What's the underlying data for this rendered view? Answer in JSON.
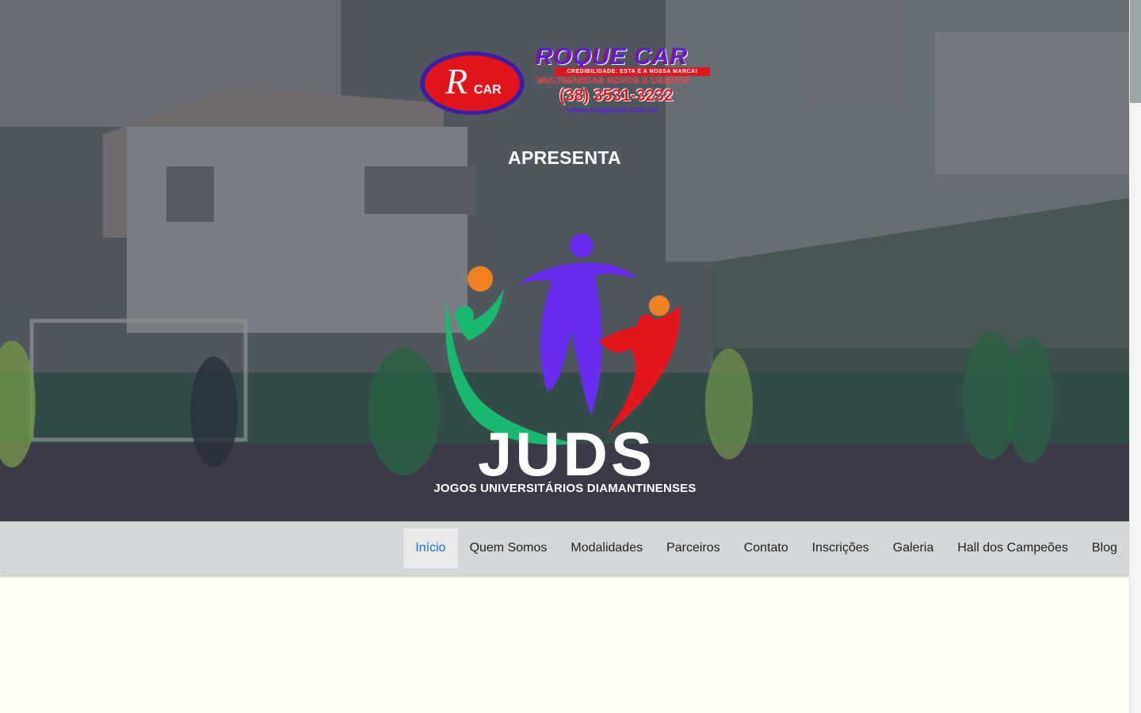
{
  "sponsor": {
    "name": "ROQUE CAR",
    "tagline": "CREDIBILIDADE: ESTA É A NOSSA MARCA!",
    "subtitle": "MULTIMARCAS NOVOS E USADOS",
    "phone": "(38) 3531-3232",
    "website": "www.roquecar.com.br",
    "emblem_text": "RCAR"
  },
  "hero": {
    "presents": "APRESENTA",
    "event_acronym": "JUDS",
    "event_name": "JOGOS UNIVERSITÁRIOS DIAMANTINENSES"
  },
  "nav": {
    "items": [
      {
        "label": "Início",
        "active": true
      },
      {
        "label": "Quem Somos"
      },
      {
        "label": "Modalidades"
      },
      {
        "label": "Parceiros"
      },
      {
        "label": "Contato"
      },
      {
        "label": "Inscrições"
      },
      {
        "label": "Galeria"
      },
      {
        "label": "Hall dos Campeões"
      },
      {
        "label": "Blog"
      }
    ]
  },
  "colors": {
    "page_background": "#fefff5",
    "nav_background": "#d4d7d9",
    "nav_active_text": "#1b6fd1",
    "logo_green": "#18b86f",
    "logo_purple": "#6a2ef0",
    "logo_red": "#e3151f",
    "logo_ball": "#f08020"
  }
}
